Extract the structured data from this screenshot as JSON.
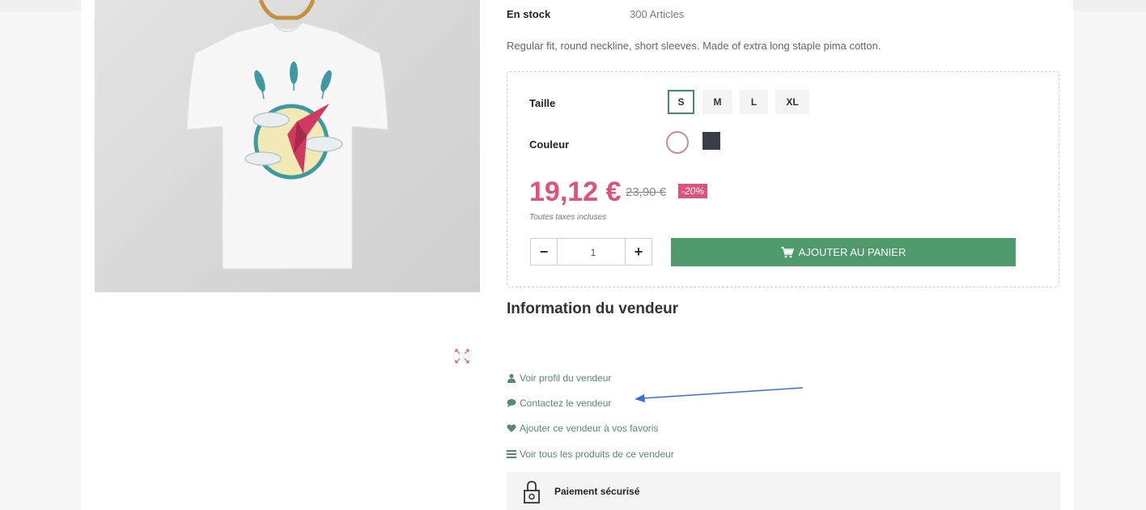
{
  "stock": {
    "label": "En stock",
    "value": "300 Articles"
  },
  "description": "Regular fit, round neckline, short sleeves. Made of extra long staple pima cotton.",
  "variants": {
    "size_label": "Taille",
    "sizes": [
      "S",
      "M",
      "L",
      "XL"
    ],
    "selected_size": "S",
    "color_label": "Couleur",
    "colors": [
      "#ffffff",
      "#3a3f47"
    ]
  },
  "price": {
    "current": "19,12 €",
    "old": "23,90 €",
    "discount": "-20%",
    "tax_note": "Toutes taxes incluses"
  },
  "cart": {
    "quantity": "1",
    "minus": "−",
    "plus": "+",
    "add_label": "AJOUTER AU PANIER"
  },
  "seller": {
    "title": "Information du vendeur",
    "links": [
      "Voir profil du vendeur",
      "Contactez le vendeur",
      "Ajouter ce vendeur à vos favoris",
      "Voir tous les produits de ce vendeur"
    ]
  },
  "reassurance": {
    "secure_payment": "Paiement sécurisé"
  },
  "colors": {
    "accent_green": "#4f9a6a",
    "price_pink": "#e0527b",
    "link_green": "#5a8a6e",
    "annotation_blue": "#3b6fd0"
  }
}
